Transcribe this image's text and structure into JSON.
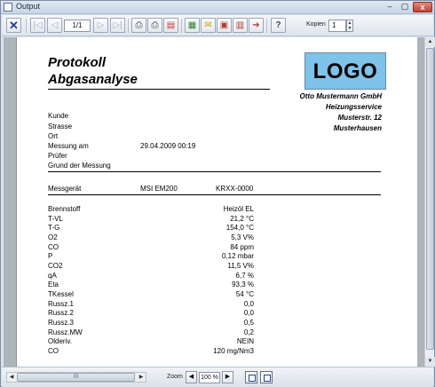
{
  "window": {
    "title": "Output",
    "min": "–",
    "max": "▢",
    "close": "x"
  },
  "toolbar": {
    "close_glyph": "✕",
    "first_glyph": "|◁",
    "prev_glyph": "◁",
    "page_value": "1/1",
    "next_glyph": "▷",
    "last_glyph": "▷|",
    "print_glyph": "⎙",
    "print2_glyph": "⎙",
    "pdf_glyph": "▤",
    "export1_glyph": "▦",
    "mail_glyph": "✉",
    "export2_glyph": "▣",
    "export3_glyph": "▥",
    "export4_glyph": "➔",
    "help_glyph": "?",
    "kopien_label": "Kopien",
    "kopien_value": "1",
    "spin_up": "▲",
    "spin_down": "▼"
  },
  "report": {
    "title_line1": "Protokoll",
    "title_line2": "Abgasanalyse",
    "logo": "LOGO",
    "company": [
      "Otto Mustermann GmbH",
      "Heizungsservice",
      "Musterstr. 12",
      "Musterhausen"
    ],
    "customer_fields": [
      {
        "label": "Kunde",
        "value": ""
      },
      {
        "label": "Strasse",
        "value": ""
      },
      {
        "label": "Ort",
        "value": ""
      },
      {
        "label": "Messung am",
        "value": "29.04.2009 00:19"
      },
      {
        "label": "Prüfer",
        "value": ""
      },
      {
        "label": "Grund der Messung",
        "value": ""
      }
    ],
    "device": {
      "label": "Messgerät",
      "model": "MSI EM200",
      "serial": "KRXX-0000"
    },
    "measurements": [
      {
        "label": "Brennstoff",
        "value": "Heizöl EL"
      },
      {
        "label": "T-VL",
        "value": "21,2 °C"
      },
      {
        "label": "T-G",
        "value": "154,0 °C"
      },
      {
        "label": "O2",
        "value": "5,3 V%"
      },
      {
        "label": "CO",
        "value": "84 ppm"
      },
      {
        "label": "P",
        "value": "0,12 mbar"
      },
      {
        "label": "CO2",
        "value": "11,5 V%"
      },
      {
        "label": "qA",
        "value": "6,7 %"
      },
      {
        "label": "Eta",
        "value": "93,3 %"
      },
      {
        "label": "TKessel",
        "value": "54 °C"
      },
      {
        "label": "Russz.1",
        "value": "0,0"
      },
      {
        "label": "Russz.2",
        "value": "0,0"
      },
      {
        "label": "Russz.3",
        "value": "0,5"
      },
      {
        "label": "Russz.MW",
        "value": "0,2"
      },
      {
        "label": "Olderiv.",
        "value": "NEIN"
      },
      {
        "label": "CO",
        "value": "120 mg/Nm3"
      }
    ]
  },
  "bottombar": {
    "scroll_left": "◀",
    "scroll_right": "▶",
    "thumb_grip": "III",
    "zoom_label": "Zoom",
    "zoom_out": "◀",
    "zoom_value": "100 %",
    "zoom_in": "▶"
  },
  "vscroll": {
    "up": "▲",
    "down": "▼"
  }
}
